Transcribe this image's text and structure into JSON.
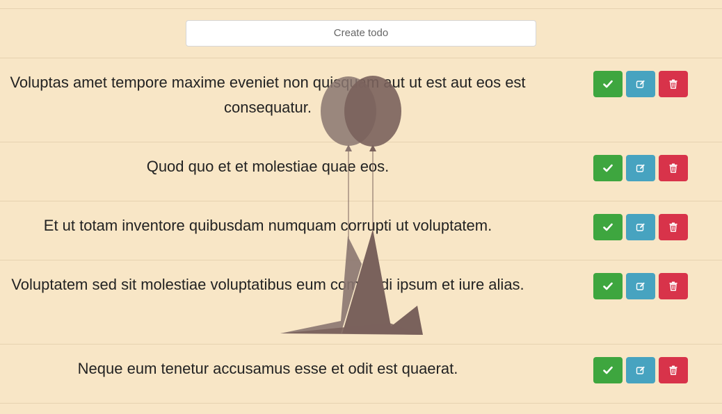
{
  "create": {
    "label": "Create todo"
  },
  "todos": [
    {
      "text": "Voluptas amet tempore maxime eveniet non quisquam aut ut est aut eos est consequatur."
    },
    {
      "text": "Quod quo et et molestiae quae eos."
    },
    {
      "text": "Et ut totam inventore quibusdam numquam corrupti ut voluptatem."
    },
    {
      "text": "Voluptatem sed sit molestiae voluptatibus eum commodi ipsum et iure alias."
    },
    {
      "text": "Neque eum tenetur accusamus esse et odit est quaerat."
    }
  ],
  "icons": {
    "done": "check-icon",
    "edit": "edit-icon",
    "delete": "trash-icon"
  },
  "colors": {
    "background": "#f8e6c6",
    "done": "#3ea63f",
    "edit": "#47a3c0",
    "delete": "#d8334a",
    "illustration": "#7a625c"
  }
}
